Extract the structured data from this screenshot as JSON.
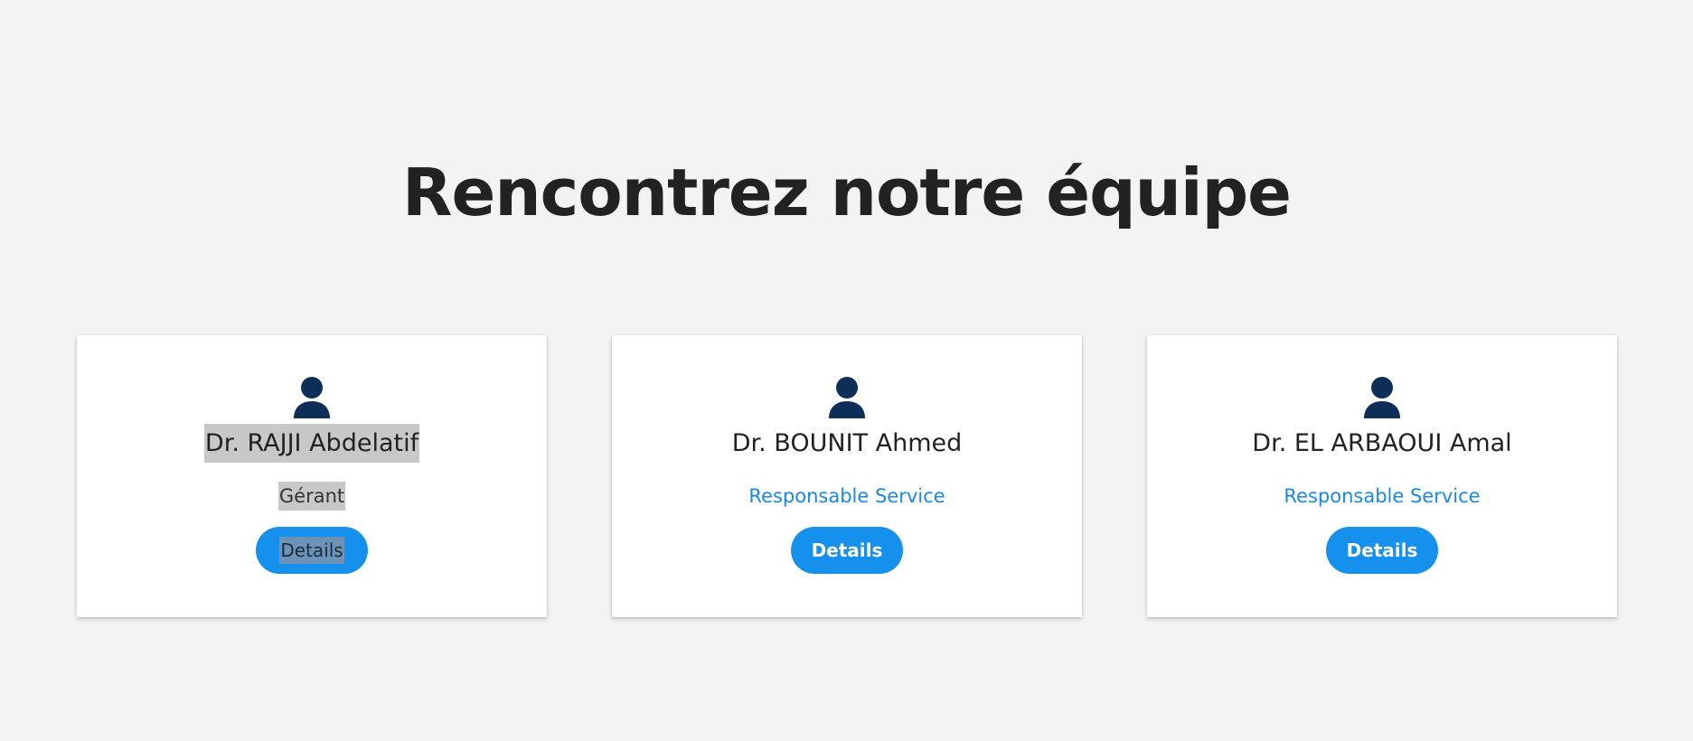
{
  "section": {
    "title": "Rencontrez notre équipe"
  },
  "colors": {
    "background": "#f3f3f3",
    "card": "#ffffff",
    "accent": "#1590ec",
    "icon": "#0d2f57",
    "role_text": "#1a88e6"
  },
  "team": [
    {
      "name": "Dr. RAJJI Abdelatif",
      "role": "Gérant",
      "button": "Details",
      "icon": "user-icon"
    },
    {
      "name": "Dr. BOUNIT Ahmed",
      "role": "Responsable Service",
      "button": "Details",
      "icon": "user-icon"
    },
    {
      "name": "Dr. EL ARBAOUI Amal",
      "role": "Responsable Service",
      "button": "Details",
      "icon": "user-icon"
    }
  ]
}
